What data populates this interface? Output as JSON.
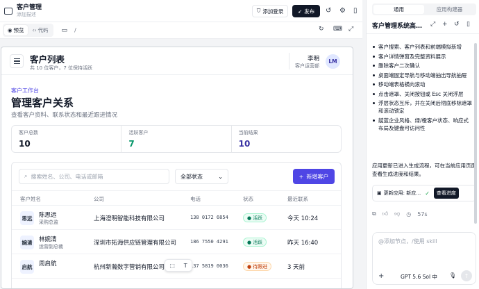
{
  "topbar": {
    "title": "客户管理",
    "subtitle": "添加描述",
    "login_label": "添加登录",
    "publish_label": "发布"
  },
  "urlbar": {
    "preview_label": "预览",
    "code_label": "代码",
    "path": "/"
  },
  "page": {
    "header_title": "客户列表",
    "header_sub": "共 10 位客户，7 位保持活跃",
    "user_name": "李明",
    "user_role": "客户运营部",
    "avatar": "LM",
    "crumb": "客户工作台",
    "heading": "管理客户关系",
    "desc": "查看客户资料、联系状态和最近跟进情况",
    "stats": [
      {
        "label": "客户总数",
        "value": "10",
        "color": "#111827"
      },
      {
        "label": "活跃客户",
        "value": "7",
        "color": "#059669"
      },
      {
        "label": "当前结果",
        "value": "10",
        "color": "#3730a3"
      }
    ],
    "search_placeholder": "搜索姓名、公司、电话或邮箱",
    "status_filter": "全部状态",
    "add_label": "新增客户",
    "columns": [
      "客户姓名",
      "公司",
      "电话",
      "状态",
      "最近联系"
    ],
    "rows": [
      {
        "avatar": "思远",
        "name": "陈思远",
        "role": "采购总监",
        "company": "上海澄明智能科技有限公司",
        "phone": "138 0172 6854",
        "status": "活跃",
        "status_type": "ok",
        "time": "今天 10:24"
      },
      {
        "avatar": "婉清",
        "name": "林婉清",
        "role": "运营副总裁",
        "company": "深圳市拓海供应链管理有限公司",
        "phone": "186 7550 4291",
        "status": "活跃",
        "status_type": "ok",
        "time": "昨天 16:40"
      },
      {
        "avatar": "启航",
        "name": "周启航",
        "role": "",
        "company": "杭州新瀚数字营销有限公司",
        "phone": "137 5819 0036",
        "status": "待跟进",
        "status_type": "warn",
        "time": "3 天前"
      }
    ]
  },
  "panel": {
    "tabs": [
      "通用",
      "应用构建器"
    ],
    "title": "客户管理系统高…",
    "items": [
      "客户搜索、客户列表和前端模拟新增",
      "客户详情弹窗及完整资料展示",
      "删除客户二次确认",
      "桌面端固定导航与移动端抽出导航抽屉",
      "移动端表格横向滚动",
      "点击遮罩、关闭按钮或 Esc 关闭浮层",
      "浮层状态互斥，并在关闭后彻底移除遮罩和滚动锁定",
      "靛蓝企业风格、绿/橙客户状态、响应式布局及键盘可访问性"
    ],
    "paragraph": "应用更新已进入生成流程，可在当前应用页面查看生成进度和结果。",
    "update_label": "更新应用: 新应…",
    "progress_label": "查看进度",
    "elapsed": "57s",
    "input_placeholder": "@添加节点，/使用 skill",
    "model": "GPT 5.6 Sol 中"
  }
}
